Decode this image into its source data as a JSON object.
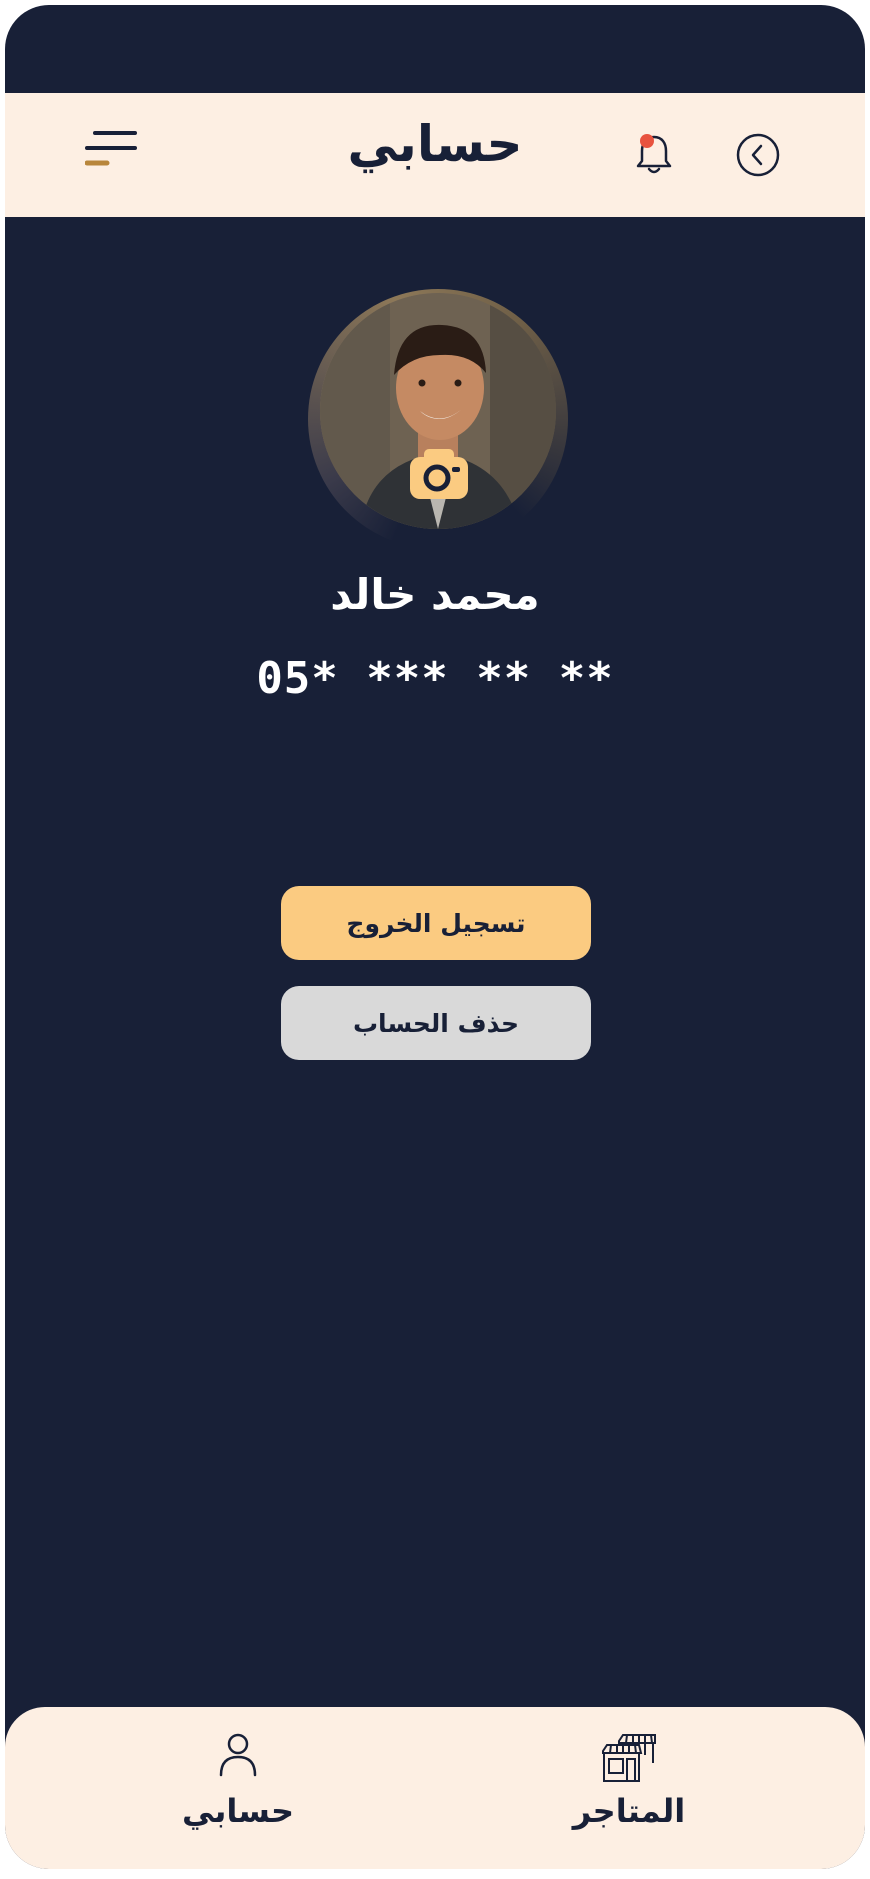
{
  "header": {
    "title": "حسابي"
  },
  "profile": {
    "name": "محمد خالد",
    "phone": "05* *** ** **"
  },
  "actions": {
    "logout_label": "تسجيل الخروج",
    "delete_label": "حذف الحساب"
  },
  "bottom_nav": {
    "stores_label": "المتاجر",
    "account_label": "حسابي"
  },
  "colors": {
    "primary_dark": "#182037",
    "header_bg": "#fdefe3",
    "accent": "#fbcb81",
    "notification_dot": "#e8533f",
    "delete_button": "#d9d9d9"
  },
  "icons": [
    "menu-icon",
    "bell-icon",
    "back-chevron-icon",
    "camera-icon",
    "store-icon",
    "user-icon"
  ]
}
